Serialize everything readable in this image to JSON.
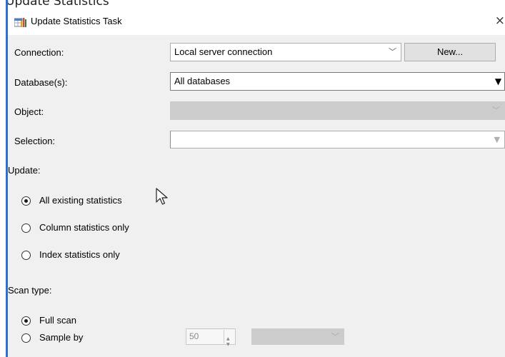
{
  "background_caption": "Update Statistics",
  "window": {
    "title": "Update Statistics Task",
    "icon": "table-statistics-icon",
    "close_glyph": "×"
  },
  "form": {
    "connection": {
      "label": "Connection:",
      "value": "Local server connection",
      "new_button": "New..."
    },
    "databases": {
      "label": "Database(s):",
      "value": "All databases"
    },
    "object": {
      "label": "Object:",
      "value": ""
    },
    "selection": {
      "label": "Selection:",
      "value": ""
    }
  },
  "update": {
    "heading": "Update:",
    "options": [
      {
        "label": "All existing statistics",
        "selected": true
      },
      {
        "label": "Column statistics only",
        "selected": false
      },
      {
        "label": "Index statistics only",
        "selected": false
      }
    ]
  },
  "scan_type": {
    "heading": "Scan type:",
    "options": [
      {
        "label": "Full scan",
        "selected": true
      },
      {
        "label": "Sample by",
        "selected": false
      }
    ],
    "sample_value": "50",
    "sample_unit": ""
  },
  "colors": {
    "panel_bg": "#f0f0f0",
    "accent_bar": "#2a6fd6",
    "disabled_field": "#cccccc"
  }
}
